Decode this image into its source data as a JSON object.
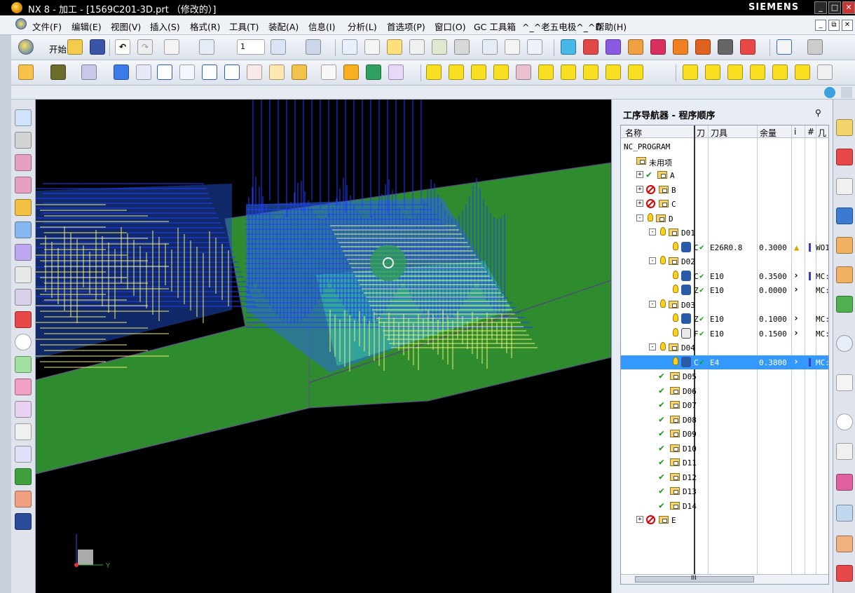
{
  "window": {
    "title": "NX 8 - 加工 - [1569C201-3D.prt （修改的）]",
    "brand": "SIEMENS",
    "controls": [
      "_",
      "□",
      "✕"
    ]
  },
  "menubar": {
    "items": [
      "文件(F)",
      "编辑(E)",
      "视图(V)",
      "插入(S)",
      "格式(R)",
      "工具(T)",
      "装配(A)",
      "信息(I)",
      "分析(L)",
      "首选项(P)",
      "窗口(O)",
      "GC 工具箱",
      "^_^老五电极^_^D",
      "帮助(H)"
    ],
    "mdi_controls": [
      "_",
      "⧉",
      "✕"
    ]
  },
  "toolbar": {
    "start_label": "开始",
    "combo_value": "1"
  },
  "navigator": {
    "title": "工序导航器 - 程序顺序",
    "pin_icon": "pin-icon",
    "columns": [
      "名称",
      "刀",
      "刀具",
      "余量",
      "i",
      "#",
      "几"
    ],
    "rows": [
      {
        "name": "NC_PROGRAM",
        "level": 0,
        "kind": "root"
      },
      {
        "name": "未用项",
        "level": 1,
        "kind": "unused"
      },
      {
        "name": "A",
        "level": 1,
        "kind": "group",
        "status": "ok",
        "expander": "+"
      },
      {
        "name": "B",
        "level": 1,
        "kind": "group",
        "status": "ban",
        "expander": "+"
      },
      {
        "name": "C",
        "level": 1,
        "kind": "group",
        "status": "ban",
        "expander": "+"
      },
      {
        "name": "D",
        "level": 1,
        "kind": "group",
        "status": "bulb",
        "expander": "-"
      },
      {
        "name": "D01",
        "level": 2,
        "kind": "group",
        "status": "bulb",
        "expander": "-"
      },
      {
        "name": "C",
        "level": 3,
        "kind": "op",
        "status": "bulb",
        "tool": "E26R0.8",
        "stock": "0.3000",
        "mark": "warn",
        "geom": "WO1"
      },
      {
        "name": "D02",
        "level": 2,
        "kind": "group",
        "status": "bulb",
        "expander": "-"
      },
      {
        "name": "C",
        "level": 3,
        "kind": "op",
        "status": "bulb",
        "tool": "E10",
        "stock": "0.3500",
        "mark": "arrow",
        "geom": "MC:"
      },
      {
        "name": "Z",
        "level": 3,
        "kind": "op",
        "status": "bulb",
        "tool": "E10",
        "stock": "0.0000",
        "mark": "arrow",
        "geom": "MC:"
      },
      {
        "name": "D03",
        "level": 2,
        "kind": "group",
        "status": "bulb",
        "expander": "-"
      },
      {
        "name": "Z",
        "level": 3,
        "kind": "op",
        "status": "bulb",
        "tool": "E10",
        "stock": "0.1000",
        "mark": "arrow",
        "geom": "MC:"
      },
      {
        "name": "F",
        "level": 3,
        "kind": "op-f",
        "status": "bulb",
        "tool": "E10",
        "stock": "0.1500",
        "mark": "arrow",
        "geom": "MC:"
      },
      {
        "name": "D04",
        "level": 2,
        "kind": "group",
        "status": "bulb",
        "expander": "-"
      },
      {
        "name": "C",
        "level": 3,
        "kind": "op",
        "status": "bulb",
        "tool": "E4",
        "stock": "0.3800",
        "mark": "arrow",
        "geom": "MC:",
        "selected": true
      },
      {
        "name": "D05",
        "level": 2,
        "kind": "group",
        "status": "ok"
      },
      {
        "name": "D06",
        "level": 2,
        "kind": "group",
        "status": "ok"
      },
      {
        "name": "D07",
        "level": 2,
        "kind": "group",
        "status": "ok"
      },
      {
        "name": "D08",
        "level": 2,
        "kind": "group",
        "status": "ok"
      },
      {
        "name": "D09",
        "level": 2,
        "kind": "group",
        "status": "ok"
      },
      {
        "name": "D10",
        "level": 2,
        "kind": "group",
        "status": "ok"
      },
      {
        "name": "D11",
        "level": 2,
        "kind": "group",
        "status": "ok"
      },
      {
        "name": "D12",
        "level": 2,
        "kind": "group",
        "status": "ok"
      },
      {
        "name": "D13",
        "level": 2,
        "kind": "group",
        "status": "ok"
      },
      {
        "name": "D14",
        "level": 2,
        "kind": "group",
        "status": "ok"
      },
      {
        "name": "E",
        "level": 1,
        "kind": "group",
        "status": "ban",
        "expander": "+"
      }
    ],
    "scroll_glyph": "III"
  },
  "viewport": {
    "axis_label": "Y",
    "background": "#000000",
    "surface_color": "#2e8b2e",
    "toolpath_blue": "#1f3dff",
    "toolpath_yellow": "#f0f070"
  }
}
